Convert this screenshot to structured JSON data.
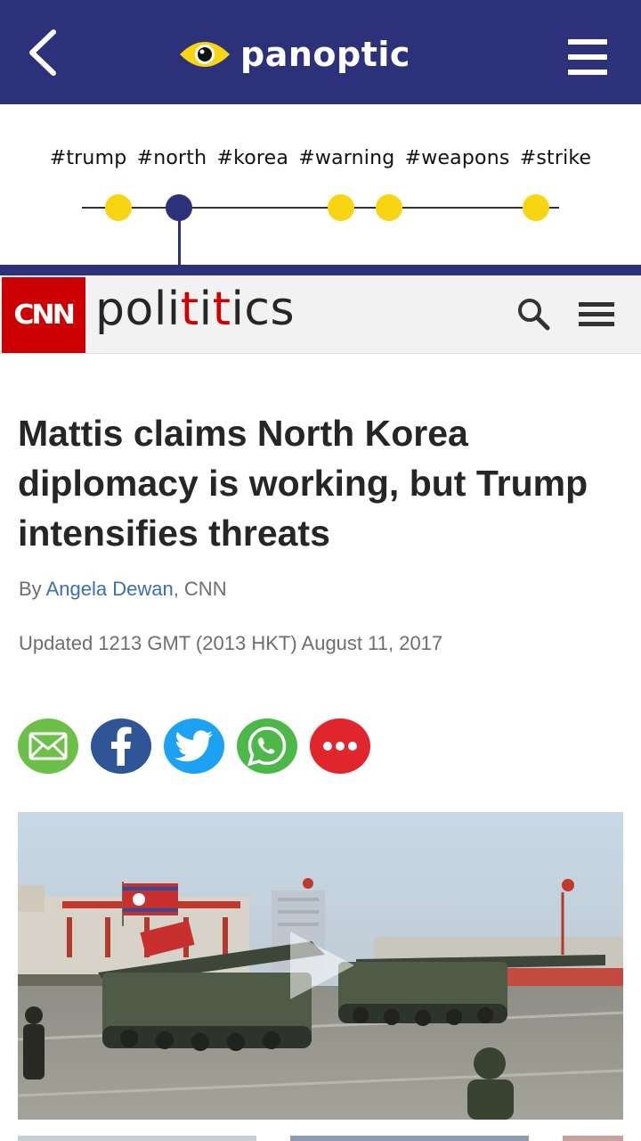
{
  "app": {
    "brand_name": "panoptic",
    "accent_color": "#2d3179",
    "highlight_color": "#f7d512"
  },
  "hashtags": [
    "#trump",
    "#north",
    "#korea",
    "#warning",
    "#weapons",
    "#strike"
  ],
  "timeline": {
    "points": 5,
    "active_index": 1
  },
  "source": {
    "logo_text": "CNN",
    "section_pre": "poli",
    "section_accent1": "t",
    "section_mid": "i",
    "section_accent2": "t",
    "section_post": "ics",
    "brand_color": "#cc0000"
  },
  "article": {
    "headline": "Mattis claims North Korea diplomacy is working, but Trump intensifies threats",
    "byline_prefix": "By ",
    "author": "Angela Dewan",
    "byline_suffix": ", CNN",
    "updated": "Updated 1213 GMT (2013 HKT) August 11, 2017"
  },
  "share_buttons": [
    {
      "icon": "mail-icon",
      "color": "#6cc04a"
    },
    {
      "icon": "facebook-icon",
      "color": "#2f5597"
    },
    {
      "icon": "twitter-icon",
      "color": "#1da1f2"
    },
    {
      "icon": "whatsapp-icon",
      "color": "#4db84a"
    },
    {
      "icon": "more-icon",
      "color": "#e0262c"
    }
  ],
  "media": {
    "type": "video",
    "icon": "play-icon"
  }
}
